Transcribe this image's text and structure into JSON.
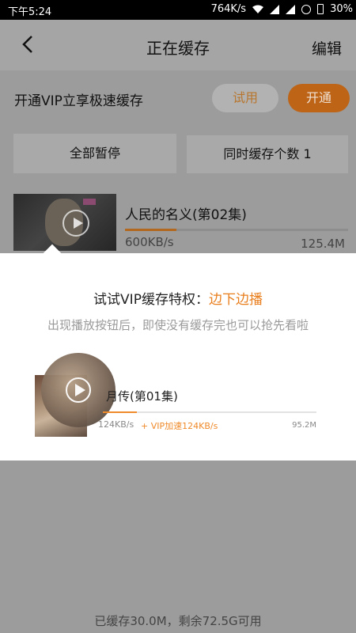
{
  "status_bar": {
    "time": "下午5:24",
    "net_speed": "764K/s",
    "battery": "30%"
  },
  "header": {
    "title": "正在缓存",
    "edit_label": "编辑"
  },
  "vip_bar": {
    "text": "开通VIP立享极速缓存",
    "try_label": "试用",
    "open_label": "开通"
  },
  "actions": {
    "pause_all_label": "全部暂停",
    "concurrent_label": "同时缓存个数 1"
  },
  "download_item": {
    "name": "人民的名义(第02集)",
    "speed": "600KB/s",
    "size": "125.4M",
    "progress": 0.23
  },
  "popup": {
    "headline_prefix": "试试VIP缓存特权：",
    "headline_highlight": "边下边播",
    "description": "出现播放按钮后，即使没有缓存完也可以抢先看啦",
    "demo_item": {
      "name": "月传(第01集)",
      "speed": "124KB/s",
      "boost": "+ VIP加速124KB/s",
      "size": "95.2M",
      "progress": 0.16
    }
  },
  "footer": {
    "storage_text": "已缓存30.0M，剩余72.5G可用"
  },
  "colors": {
    "accent": "#f08b2c",
    "overlay": "#9c9c9c"
  }
}
